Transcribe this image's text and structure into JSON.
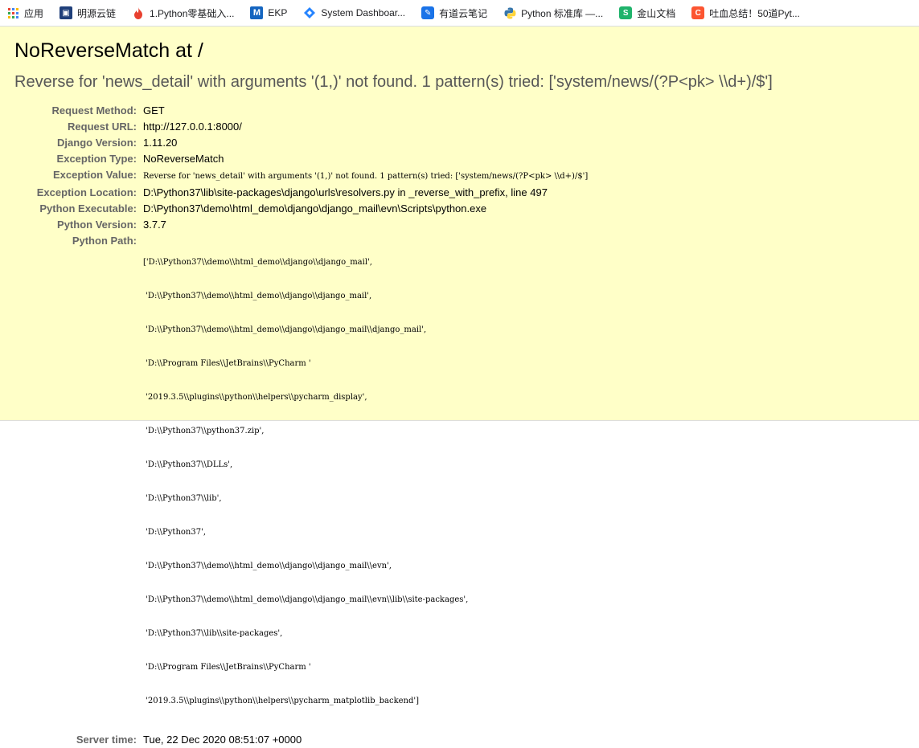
{
  "bookmarks": [
    {
      "label": "应用",
      "icon": "apps-grid-icon"
    },
    {
      "label": "明源云链",
      "icon": "mingyuan-logo-icon"
    },
    {
      "label": "1.Python零基础入...",
      "icon": "flame-icon"
    },
    {
      "label": "EKP",
      "icon": "ekp-logo-icon"
    },
    {
      "label": "System Dashboar...",
      "icon": "jira-diamond-icon"
    },
    {
      "label": "有道云笔记",
      "icon": "youdao-note-icon"
    },
    {
      "label": "Python 标准库 —...",
      "icon": "python-logo-icon"
    },
    {
      "label": "金山文档",
      "icon": "kingsoft-docs-icon"
    },
    {
      "label": "吐血总结！50道Pyt...",
      "icon": "csdn-c-icon"
    }
  ],
  "error": {
    "title": "NoReverseMatch at /",
    "message": "Reverse for 'news_detail' with arguments '(1,)' not found. 1 pattern(s) tried: ['system/news/(?P<pk> \\\\d+)/$']"
  },
  "meta": {
    "request_method_label": "Request Method:",
    "request_method": "GET",
    "request_url_label": "Request URL:",
    "request_url": "http://127.0.0.1:8000/",
    "django_version_label": "Django Version:",
    "django_version": "1.11.20",
    "exception_type_label": "Exception Type:",
    "exception_type": "NoReverseMatch",
    "exception_value_label": "Exception Value:",
    "exception_value": "Reverse for 'news_detail' with arguments '(1,)' not found. 1 pattern(s) tried: ['system/news/(?P<pk> \\\\d+)/$']",
    "exception_location_label": "Exception Location:",
    "exception_location": "D:\\Python37\\lib\\site-packages\\django\\urls\\resolvers.py in _reverse_with_prefix, line 497",
    "python_executable_label": "Python Executable:",
    "python_executable": "D:\\Python37\\demo\\html_demo\\django\\django_mail\\evn\\Scripts\\python.exe",
    "python_version_label": "Python Version:",
    "python_version": "3.7.7",
    "python_path_label": "Python Path:",
    "python_path": [
      "['D:\\\\Python37\\\\demo\\\\html_demo\\\\django\\\\django_mail',",
      " 'D:\\\\Python37\\\\demo\\\\html_demo\\\\django\\\\django_mail',",
      " 'D:\\\\Python37\\\\demo\\\\html_demo\\\\django\\\\django_mail\\\\django_mail',",
      " 'D:\\\\Program Files\\\\JetBrains\\\\PyCharm '",
      " '2019.3.5\\\\plugins\\\\python\\\\helpers\\\\pycharm_display',",
      " 'D:\\\\Python37\\\\python37.zip',",
      " 'D:\\\\Python37\\\\DLLs',",
      " 'D:\\\\Python37\\\\lib',",
      " 'D:\\\\Python37',",
      " 'D:\\\\Python37\\\\demo\\\\html_demo\\\\django\\\\django_mail\\\\evn',",
      " 'D:\\\\Python37\\\\demo\\\\html_demo\\\\django\\\\django_mail\\\\evn\\\\lib\\\\site-packages',",
      " 'D:\\\\Python37\\\\lib\\\\site-packages',",
      " 'D:\\\\Program Files\\\\JetBrains\\\\PyCharm '",
      " '2019.3.5\\\\plugins\\\\python\\\\helpers\\\\pycharm_matplotlib_backend']"
    ],
    "server_time_label": "Server time:",
    "server_time": "Tue, 22 Dec 2020 08:51:07 +0000"
  },
  "colors": {
    "summary_bg": "#ffffc8",
    "label_gray": "#666666",
    "subtitle_gray": "#575757"
  }
}
